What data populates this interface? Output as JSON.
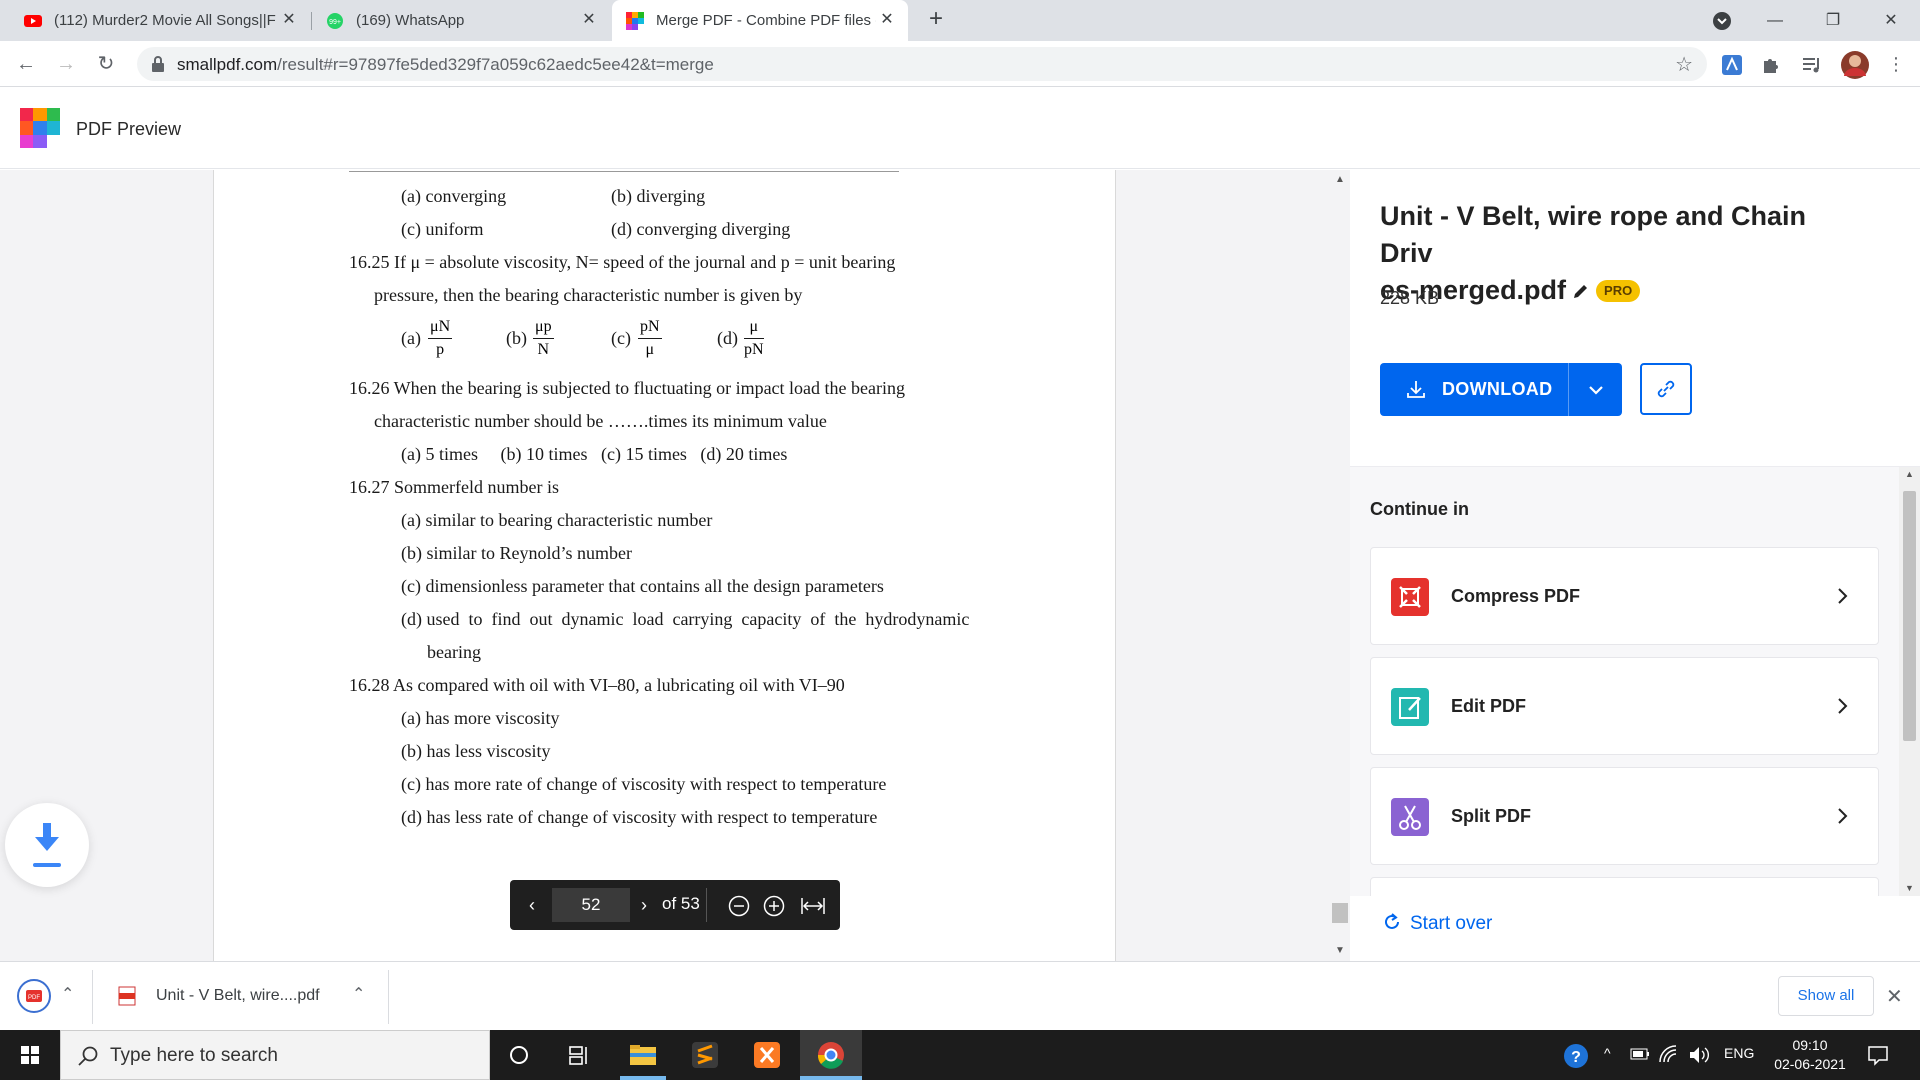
{
  "browser": {
    "tabs": [
      {
        "title": "(112) Murder2 Movie All Songs||F",
        "favicon": "youtube-icon"
      },
      {
        "title": "(169) WhatsApp",
        "favicon": "whatsapp-icon"
      },
      {
        "title": "Merge PDF - Combine PDF files o",
        "favicon": "smallpdf-icon"
      }
    ],
    "url_host": "smallpdf.com",
    "url_path": "/result#r=97897fe5ded329f7a059c62aedc5ee42&t=merge",
    "whatsapp_badge": "99+"
  },
  "app": {
    "title": "PDF Preview"
  },
  "document": {
    "lines": [
      "(a) converging",
      "(b) diverging",
      "(c) uniform",
      "(d) converging diverging",
      "16.25  If μ = absolute viscosity, N= speed of the journal and p = unit bearing",
      "pressure, then the bearing characteristic number is given by",
      "16.26  When the bearing is subjected to fluctuating or impact load the bearing",
      "characteristic number should be …….times its minimum value",
      "(a) 5 times     (b) 10 times   (c) 15 times   (d) 20 times",
      "16.27  Sommerfeld number is",
      "(a) similar to bearing characteristic number",
      "(b) similar to Reynold’s number",
      "(c) dimensionless parameter that contains all the design parameters",
      "(d) used  to  find  out  dynamic  load  carrying  capacity  of  the  hydrodynamic",
      "bearing",
      "16.28  As compared with oil with VI–80, a lubricating oil with VI–90",
      "(a) has more viscosity",
      "(b) has less viscosity",
      "(c) has more rate of change of viscosity with respect to temperature",
      "(d) has less rate of change of viscosity with respect to temperature"
    ],
    "fractions": [
      {
        "label": "(a)",
        "num": "μN",
        "den": "p"
      },
      {
        "label": "(b)",
        "num": "μp",
        "den": "N"
      },
      {
        "label": "(c)",
        "num": "pN",
        "den": "μ"
      },
      {
        "label": "(d)",
        "num": "μ",
        "den": "pN"
      }
    ]
  },
  "pager": {
    "page": "52",
    "of_label": "of 53"
  },
  "file": {
    "name": "Unit - V Belt, wire rope and Chain Driv\nes-merged.pdf",
    "badge": "PRO",
    "size": "228 KB"
  },
  "actions": {
    "download_label": "DOWNLOAD"
  },
  "continue": {
    "heading": "Continue in",
    "items": [
      {
        "label": "Compress PDF",
        "color": "#e5322d"
      },
      {
        "label": "Edit PDF",
        "color": "#22b8b0"
      },
      {
        "label": "Split PDF",
        "color": "#8a63d2"
      }
    ]
  },
  "start_over": "Start over",
  "shelf": {
    "file": "Unit - V Belt,  wire....pdf",
    "show_all": "Show all"
  },
  "taskbar": {
    "search_placeholder": "Type here to search",
    "lang": "ENG",
    "time": "09:10",
    "date": "02-06-2021"
  },
  "colors": {
    "accent": "#0066ee",
    "pro": "#f5c100",
    "pager_bg": "#1f1f1f"
  }
}
